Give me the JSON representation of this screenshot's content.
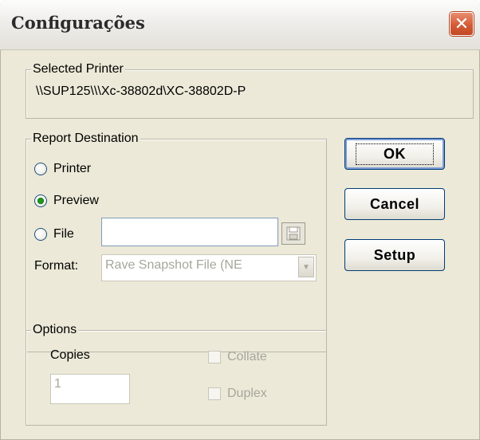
{
  "window": {
    "title": "Configurações",
    "close_label": "✕"
  },
  "selected_printer": {
    "legend": "Selected Printer",
    "path": "\\\\SUP125\\\\\\Xc-38802d\\XC-38802D-P"
  },
  "report_destination": {
    "legend": "Report Destination",
    "printer_label": "Printer",
    "preview_label": "Preview",
    "file_label": "File",
    "file_value": "",
    "format_label": "Format:",
    "format_value": "Rave Snapshot File (NE",
    "selected": "preview"
  },
  "buttons": {
    "ok": "OK",
    "cancel": "Cancel",
    "setup": "Setup"
  },
  "options": {
    "legend": "Options",
    "copies_label": "Copies",
    "copies_value": "1",
    "collate_label": "Collate",
    "duplex_label": "Duplex"
  },
  "colors": {
    "dialog_bg": "#ece9d8",
    "close_button": "#d45c36",
    "radio_dot": "#1d9a19",
    "disabled_text": "#a7a69b"
  },
  "icons": {
    "close": "close-icon",
    "save": "floppy-disk-icon",
    "dropdown": "chevron-down-icon"
  }
}
